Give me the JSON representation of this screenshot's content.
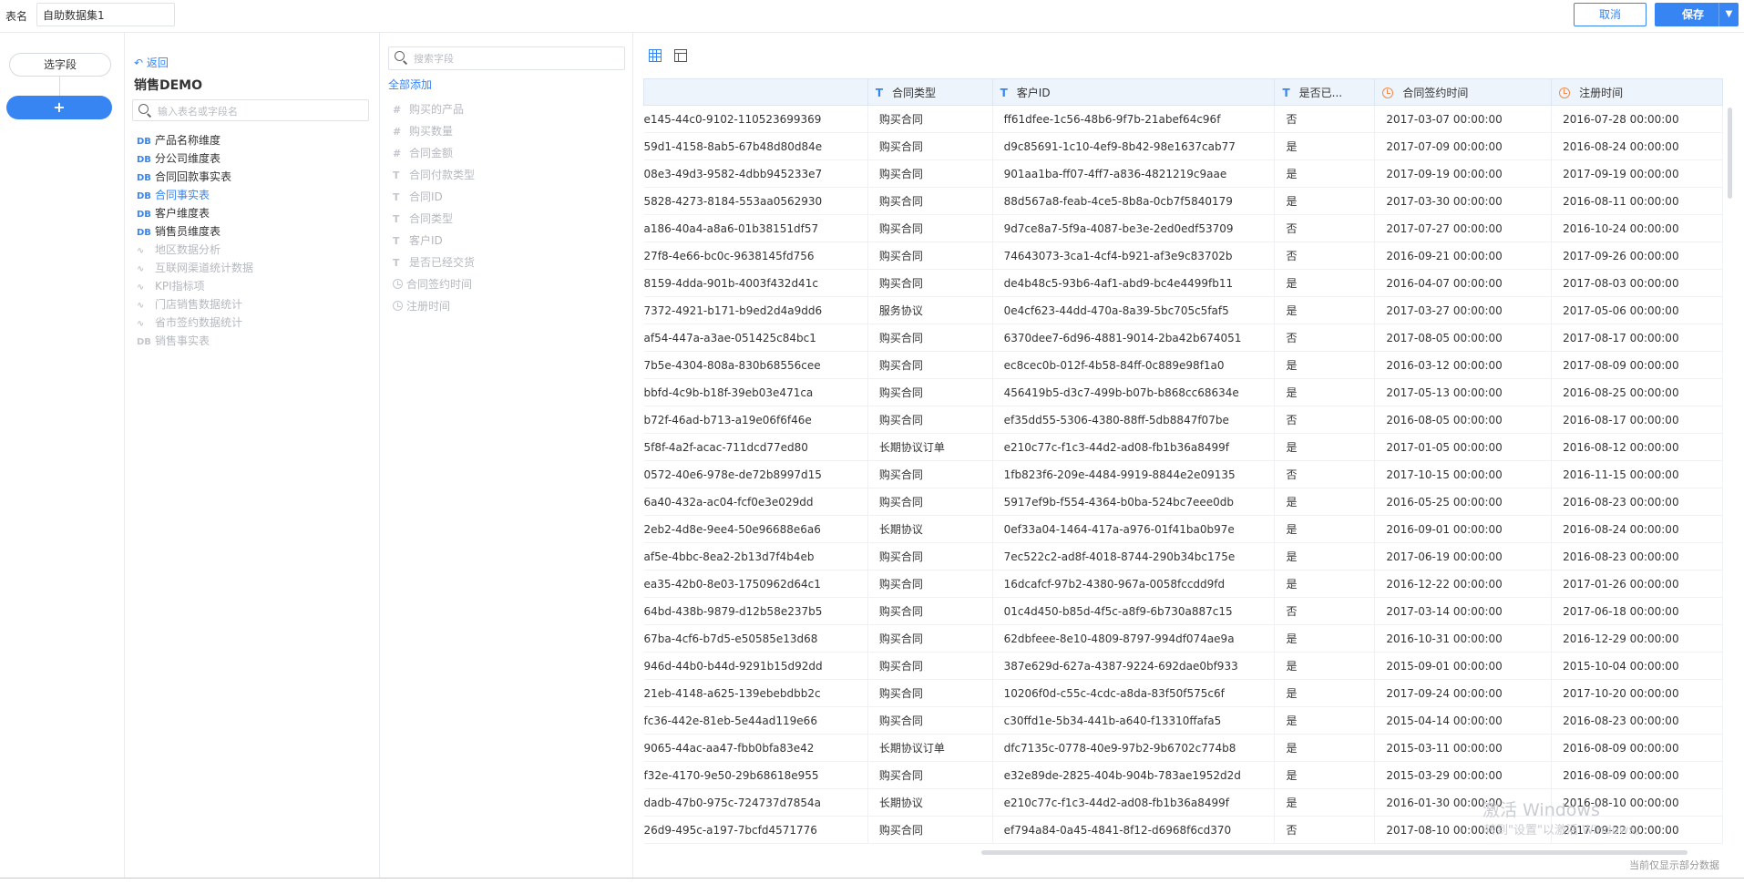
{
  "topbar": {
    "name_label": "表名",
    "name_value": "自助数据集1",
    "cancel_label": "取消",
    "save_label": "保存"
  },
  "steps": {
    "select_label": "选字段",
    "add_label": "+"
  },
  "tables": {
    "back_label": "返回",
    "package_title": "销售DEMO",
    "search_placeholder": "输入表名或字段名",
    "items": [
      {
        "icon": "DB",
        "label": "产品名称维度"
      },
      {
        "icon": "DB",
        "label": "分公司维度表"
      },
      {
        "icon": "DB",
        "label": "合同回款事实表"
      },
      {
        "icon": "DB",
        "label": "合同事实表"
      },
      {
        "icon": "DB",
        "label": "客户维度表"
      },
      {
        "icon": "DB",
        "label": "销售员维度表"
      },
      {
        "icon": "chart-icon",
        "label": "地区数据分析"
      },
      {
        "icon": "chart-icon",
        "label": "互联网渠道统计数据"
      },
      {
        "icon": "chart-icon",
        "label": "KPI指标项"
      },
      {
        "icon": "chart-icon",
        "label": "门店销售数据统计"
      },
      {
        "icon": "chart-icon",
        "label": "省市签约数据统计"
      },
      {
        "icon": "DB",
        "label": "销售事实表"
      }
    ]
  },
  "fields": {
    "search_placeholder": "搜索字段",
    "add_all_label": "全部添加",
    "items": [
      {
        "icon": "#",
        "label": "购买的产品"
      },
      {
        "icon": "#",
        "label": "购买数量"
      },
      {
        "icon": "#",
        "label": "合同金额"
      },
      {
        "icon": "T",
        "label": "合同付款类型"
      },
      {
        "icon": "T",
        "label": "合同ID"
      },
      {
        "icon": "T",
        "label": "合同类型"
      },
      {
        "icon": "T",
        "label": "客户ID"
      },
      {
        "icon": "T",
        "label": "是否已经交货"
      },
      {
        "icon": "clock-icon",
        "label": "合同签约时间"
      },
      {
        "icon": "clock-icon",
        "label": "注册时间"
      }
    ]
  },
  "preview": {
    "columns": [
      {
        "icon": "",
        "label": ""
      },
      {
        "icon": "T",
        "label": "合同类型"
      },
      {
        "icon": "T",
        "label": "客户ID"
      },
      {
        "icon": "T",
        "label": "是否已..."
      },
      {
        "icon": "clock-icon",
        "label": "合同签约时间"
      },
      {
        "icon": "clock-icon",
        "label": "注册时间"
      }
    ],
    "rows": [
      [
        "e145-44c0-9102-110523699369",
        "购买合同",
        "ff61dfee-1c56-48b6-9f7b-21abef64c96f",
        "否",
        "2017-03-07 00:00:00",
        "2016-07-28 00:00:00"
      ],
      [
        "59d1-4158-8ab5-67b48d80d84e",
        "购买合同",
        "d9c85691-1c10-4ef9-8b42-98e1637cab77",
        "是",
        "2017-07-09 00:00:00",
        "2016-08-24 00:00:00"
      ],
      [
        "08e3-49d3-9582-4dbb945233e7",
        "购买合同",
        "901aa1ba-ff07-4ff7-a836-4821219c9aae",
        "是",
        "2017-09-19 00:00:00",
        "2017-09-19 00:00:00"
      ],
      [
        "5828-4273-8184-553aa0562930",
        "购买合同",
        "88d567a8-feab-4ce5-8b8a-0cb7f5840179",
        "是",
        "2017-03-30 00:00:00",
        "2016-08-11 00:00:00"
      ],
      [
        "a186-40a4-a8a6-01b38151df57",
        "购买合同",
        "9d7ce8a7-5f9a-4087-be3e-2ed0edf53709",
        "否",
        "2017-07-27 00:00:00",
        "2016-10-24 00:00:00"
      ],
      [
        "27f8-4e66-bc0c-9638145fd756",
        "购买合同",
        "74643073-3ca1-4cf4-b921-af3e9c83702b",
        "否",
        "2016-09-21 00:00:00",
        "2017-09-26 00:00:00"
      ],
      [
        "8159-4dda-901b-4003f432d41c",
        "购买合同",
        "de4b48c5-93b6-4af1-abd9-bc4e4499fb11",
        "是",
        "2016-04-07 00:00:00",
        "2017-08-03 00:00:00"
      ],
      [
        "7372-4921-b171-b9ed2d4a9dd6",
        "服务协议",
        "0e4cf623-44dd-470a-8a39-5bc705c5faf5",
        "是",
        "2017-03-27 00:00:00",
        "2017-05-06 00:00:00"
      ],
      [
        "af54-447a-a3ae-051425c84bc1",
        "购买合同",
        "6370dee7-6d96-4881-9014-2ba42b674051",
        "否",
        "2017-08-05 00:00:00",
        "2017-08-17 00:00:00"
      ],
      [
        "7b5e-4304-808a-830b68556cee",
        "购买合同",
        "ec8cec0b-012f-4b58-84ff-0c889e98f1a0",
        "是",
        "2016-03-12 00:00:00",
        "2017-08-09 00:00:00"
      ],
      [
        "bbfd-4c9b-b18f-39eb03e471ca",
        "购买合同",
        "456419b5-d3c7-499b-b07b-b868cc68634e",
        "是",
        "2017-05-13 00:00:00",
        "2016-08-25 00:00:00"
      ],
      [
        "b72f-46ad-b713-a19e06f6f46e",
        "购买合同",
        "ef35dd55-5306-4380-88ff-5db8847f07be",
        "否",
        "2016-08-05 00:00:00",
        "2016-08-17 00:00:00"
      ],
      [
        "5f8f-4a2f-acac-711dcd77ed80",
        "长期协议订单",
        "e210c77c-f1c3-44d2-ad08-fb1b36a8499f",
        "是",
        "2017-01-05 00:00:00",
        "2016-08-12 00:00:00"
      ],
      [
        "0572-40e6-978e-de72b8997d15",
        "购买合同",
        "1fb823f6-209e-4484-9919-8844e2e09135",
        "否",
        "2017-10-15 00:00:00",
        "2016-11-15 00:00:00"
      ],
      [
        "6a40-432a-ac04-fcf0e3e029dd",
        "购买合同",
        "5917ef9b-f554-4364-b0ba-524bc7eee0db",
        "是",
        "2016-05-25 00:00:00",
        "2016-08-23 00:00:00"
      ],
      [
        "2eb2-4d8e-9ee4-50e96688e6a6",
        "长期协议",
        "0ef33a04-1464-417a-a976-01f41ba0b97e",
        "是",
        "2016-09-01 00:00:00",
        "2016-08-24 00:00:00"
      ],
      [
        "af5e-4bbc-8ea2-2b13d7f4b4eb",
        "购买合同",
        "7ec522c2-ad8f-4018-8744-290b34bc175e",
        "是",
        "2017-06-19 00:00:00",
        "2016-08-23 00:00:00"
      ],
      [
        "ea35-42b0-8e03-1750962d64c1",
        "购买合同",
        "16dcafcf-97b2-4380-967a-0058fccdd9fd",
        "是",
        "2016-12-22 00:00:00",
        "2017-01-26 00:00:00"
      ],
      [
        "64bd-438b-9879-d12b58e237b5",
        "购买合同",
        "01c4d450-b85d-4f5c-a8f9-6b730a887c15",
        "否",
        "2017-03-14 00:00:00",
        "2017-06-18 00:00:00"
      ],
      [
        "67ba-4cf6-b7d5-e50585e13d68",
        "购买合同",
        "62dbfeee-8e10-4809-8797-994df074ae9a",
        "是",
        "2016-10-31 00:00:00",
        "2016-12-29 00:00:00"
      ],
      [
        "946d-44b0-b44d-9291b15d92dd",
        "购买合同",
        "387e629d-627a-4387-9224-692dae0bf933",
        "是",
        "2015-09-01 00:00:00",
        "2015-10-04 00:00:00"
      ],
      [
        "21eb-4148-a625-139ebebdbb2c",
        "购买合同",
        "10206f0d-c55c-4cdc-a8da-83f50f575c6f",
        "是",
        "2017-09-24 00:00:00",
        "2017-10-20 00:00:00"
      ],
      [
        "fc36-442e-81eb-5e44ad119e66",
        "购买合同",
        "c30ffd1e-5b34-441b-a640-f13310ffafa5",
        "是",
        "2015-04-14 00:00:00",
        "2016-08-23 00:00:00"
      ],
      [
        "9065-44ac-aa47-fbb0bfa83e42",
        "长期协议订单",
        "dfc7135c-0778-40e9-97b2-9b6702c774b8",
        "是",
        "2015-03-11 00:00:00",
        "2016-08-09 00:00:00"
      ],
      [
        "f32e-4170-9e50-29b68618e955",
        "购买合同",
        "e32e89de-2825-404b-904b-783ae1952d2d",
        "是",
        "2015-03-29 00:00:00",
        "2016-08-09 00:00:00"
      ],
      [
        "dadb-47b0-975c-724737d7854a",
        "长期协议",
        "e210c77c-f1c3-44d2-ad08-fb1b36a8499f",
        "是",
        "2016-01-30 00:00:00",
        "2016-08-10 00:00:00"
      ],
      [
        "26d9-495c-a197-7bcfd4571776",
        "购买合同",
        "ef794a84-0a45-4841-8f12-d6968f6cd370",
        "否",
        "2017-08-10 00:00:00",
        "2017-09-22 00:00:00"
      ]
    ],
    "footer_note": "当前仅显示部分数据"
  },
  "watermark": {
    "line1": "激活 Windows",
    "line2": "转到\"设置\"以激活 Windows。"
  }
}
